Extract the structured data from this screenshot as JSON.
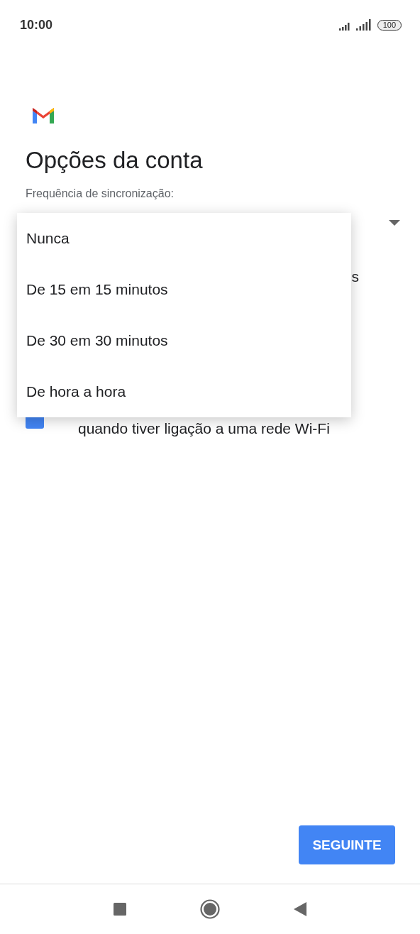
{
  "status_bar": {
    "time": "10:00",
    "battery": "100"
  },
  "title": "Opções da conta",
  "sync_label": "Frequência de sincronização:",
  "hidden_option_fragment": "s",
  "wifi_option": {
    "label": "quando tiver ligação a uma rede Wi-Fi",
    "checked": true
  },
  "dropdown_menu": {
    "items": [
      {
        "label": "Nunca"
      },
      {
        "label": "De 15 em 15 minutos"
      },
      {
        "label": "De 30 em 30 minutos"
      },
      {
        "label": "De hora a hora"
      }
    ]
  },
  "next_button": "SEGUINTE"
}
